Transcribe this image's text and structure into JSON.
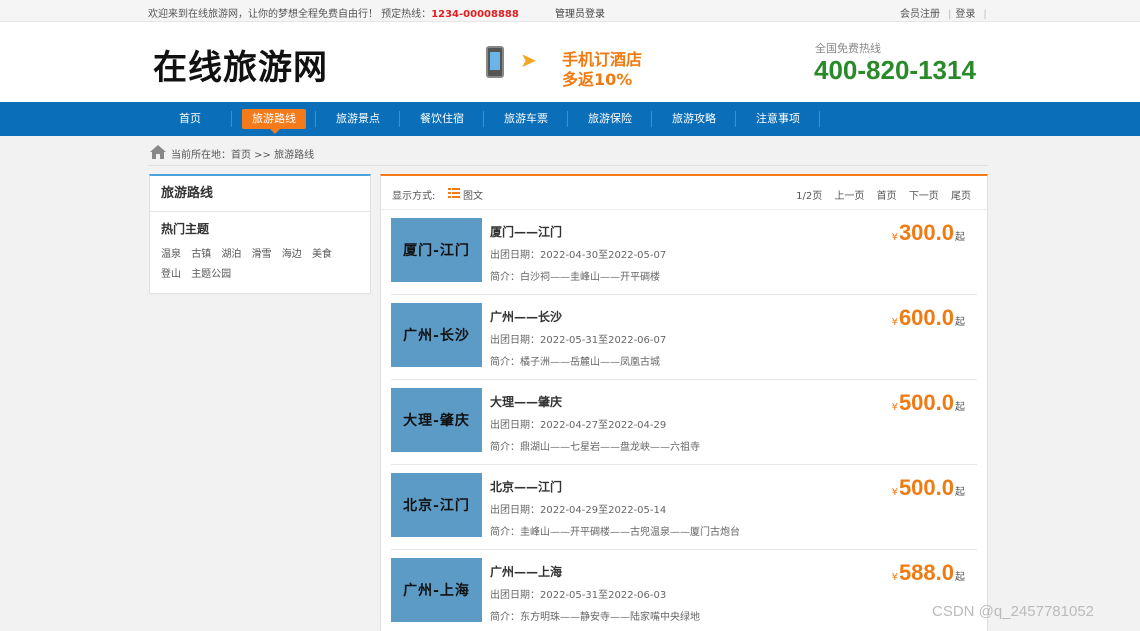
{
  "topbar": {
    "welcome": "欢迎来到在线旅游网，让你的梦想全程免费自由行！ 预定热线：",
    "hotline": "1234-00008888",
    "admin_login": "管理员登录",
    "member_register": "会员注册",
    "login": "登录"
  },
  "header": {
    "logo": "在线旅游网",
    "promo_line1": "手机订酒店",
    "promo_line2": "多返10%",
    "hotline_label": "全国免费热线",
    "hotline_number": "400-820-1314"
  },
  "nav": {
    "items": [
      {
        "label": "首页"
      },
      {
        "label": "旅游路线"
      },
      {
        "label": "旅游景点"
      },
      {
        "label": "餐饮住宿"
      },
      {
        "label": "旅游车票"
      },
      {
        "label": "旅游保险"
      },
      {
        "label": "旅游攻略"
      },
      {
        "label": "注意事项"
      }
    ],
    "active_index": 1
  },
  "breadcrumb": {
    "text": "当前所在地：首页 >> 旅游路线"
  },
  "sidebar": {
    "title": "旅游路线",
    "subtitle": "热门主题",
    "tags": [
      "温泉",
      "古镇",
      "湖泊",
      "滑雪",
      "海边",
      "美食",
      "登山",
      "主题公园"
    ]
  },
  "toolbar": {
    "mode_label": "显示方式:",
    "mode_text": "图文",
    "page_info": "1/2页",
    "prev": "上一页",
    "first": "首页",
    "next": "下一页",
    "last": "尾页"
  },
  "routes": [
    {
      "thumb": "厦门-江门",
      "name": "厦门——江门",
      "dates": "出团日期：2022-04-30至2022-05-07",
      "intro": "简介：白沙祠——圭峰山——开平碉楼",
      "price": "300.0"
    },
    {
      "thumb": "广州-长沙",
      "name": "广州——长沙",
      "dates": "出团日期：2022-05-31至2022-06-07",
      "intro": "简介：橘子洲——岳麓山——凤凰古城",
      "price": "600.0"
    },
    {
      "thumb": "大理-肇庆",
      "name": "大理——肇庆",
      "dates": "出团日期：2022-04-27至2022-04-29",
      "intro": "简介：鼎湖山——七星岩——盘龙峡——六祖寺",
      "price": "500.0"
    },
    {
      "thumb": "北京-江门",
      "name": "北京——江门",
      "dates": "出团日期：2022-04-29至2022-05-14",
      "intro": "简介：圭峰山——开平碉楼——古兜温泉——厦门古炮台",
      "price": "500.0"
    },
    {
      "thumb": "广州-上海",
      "name": "广州——上海",
      "dates": "出团日期：2022-05-31至2022-06-03",
      "intro": "简介：东方明珠——静安寺——陆家嘴中央绿地",
      "price": "588.0"
    }
  ],
  "price_currency": "¥",
  "price_suffix": "起",
  "watermark": "CSDN @q_2457781052",
  "colors": {
    "nav_blue": "#0a6eb8",
    "accent_orange": "#f47a1a",
    "hotline_green": "#2a8a2a",
    "hotline_red": "#e02020",
    "thumb_blue": "#5b9bc6"
  }
}
